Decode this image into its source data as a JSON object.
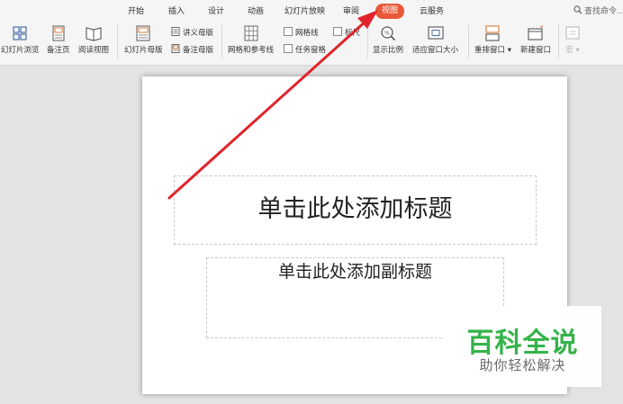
{
  "tabs": [
    {
      "label": "开始",
      "active": false
    },
    {
      "label": "插入",
      "active": false
    },
    {
      "label": "设计",
      "active": false
    },
    {
      "label": "动画",
      "active": false
    },
    {
      "label": "幻灯片放映",
      "active": false
    },
    {
      "label": "审阅",
      "active": false
    },
    {
      "label": "视图",
      "active": true
    },
    {
      "label": "云服务",
      "active": false
    }
  ],
  "search": {
    "label": "查找命令..."
  },
  "toolbar": {
    "slide_browse": "幻灯片浏览",
    "notes_page": "备注页",
    "reading_view": "阅读视图",
    "slide_master": "幻灯片母版",
    "handout_master": "讲义母版",
    "notes_master": "备注母版",
    "grid_guides": "网格和参考线",
    "gridlines": "网格线",
    "ruler": "标尺",
    "task_pane": "任务窗格",
    "show_ratio": "显示比例",
    "fit_window": "适应窗口大小",
    "arrange_window": "重排窗口",
    "new_window": "新建窗口",
    "macro": "宏"
  },
  "slide": {
    "title_placeholder": "单击此处添加标题",
    "subtitle_placeholder": "单击此处添加副标题"
  },
  "watermark": {
    "main": "百科全说",
    "sub": "助你轻松解决"
  },
  "colors": {
    "active_tab": "#e8593a",
    "arrow": "#e0242c",
    "watermark_green": "#35b349"
  }
}
